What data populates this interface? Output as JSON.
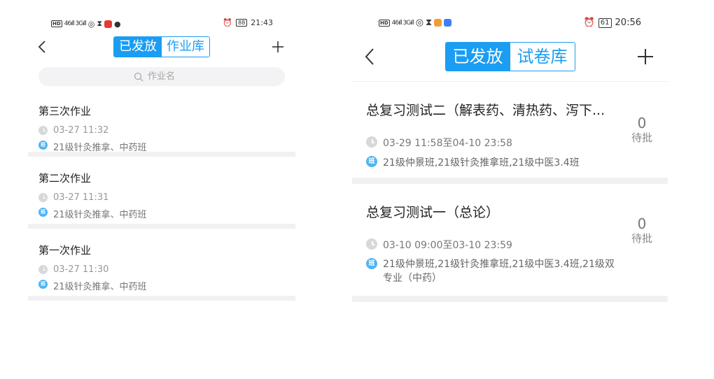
{
  "left": {
    "status": {
      "carrier": "HD",
      "signal": "46ıll 3Gıll",
      "clock": "21:43",
      "battery": "88"
    },
    "nav": {
      "tabs": [
        "已发放",
        "作业库"
      ],
      "active_tab": 0
    },
    "search": {
      "placeholder": "作业名"
    },
    "items": [
      {
        "title": "第三次作业",
        "time": "03-27 11:32",
        "classes": "21级针灸推拿、中药班"
      },
      {
        "title": "第二次作业",
        "time": "03-27 11:31",
        "classes": "21级针灸推拿、中药班"
      },
      {
        "title": "第一次作业",
        "time": "03-27 11:30",
        "classes": "21级针灸推拿、中药班"
      }
    ]
  },
  "right": {
    "status": {
      "carrier": "HD",
      "signal": "46ıll 3Gıll",
      "clock": "20:56",
      "battery": "61"
    },
    "nav": {
      "tabs": [
        "已发放",
        "试卷库"
      ],
      "active_tab": 0
    },
    "items": [
      {
        "title": "总复习测试二（解表药、清热药、泻下...",
        "time": "03-29 11:58至04-10 23:58",
        "classes": "21级仲景班,21级针灸推拿班,21级中医3.4班",
        "pending_count": "0",
        "pending_label": "待批"
      },
      {
        "title": "总复习测试一（总论）",
        "time": "03-10 09:00至03-10 23:59",
        "classes": "21级仲景班,21级针灸推拿班,21级中医3.4班,21级双专业（中药）",
        "pending_count": "0",
        "pending_label": "待批"
      }
    ]
  },
  "icons": {
    "back": "chevron-left-icon",
    "add": "plus-icon",
    "search": "search-icon",
    "clock": "clock-icon",
    "class_badge": "class-badge-icon",
    "class_badge_glyph": "班"
  },
  "colors": {
    "accent": "#1a9df2",
    "badge": "#4fb5f5",
    "divider": "#f1f1f3",
    "search_bg": "#f3f3f5"
  }
}
